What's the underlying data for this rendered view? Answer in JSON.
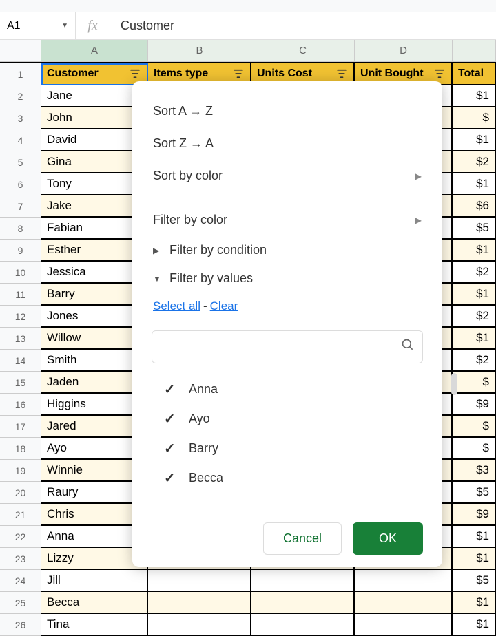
{
  "formula_bar": {
    "name_box": "A1",
    "fx": "fx",
    "value": "Customer"
  },
  "columns": [
    "A",
    "B",
    "C",
    "D",
    ""
  ],
  "header_row": {
    "a": "Customer",
    "b": "Items type",
    "c": "Units Cost",
    "d": "Unit Bought",
    "e": "Total"
  },
  "rows": [
    {
      "n": "1"
    },
    {
      "n": "2",
      "a": "Jane",
      "e": "$1"
    },
    {
      "n": "3",
      "a": "John",
      "e": "$"
    },
    {
      "n": "4",
      "a": "David",
      "e": "$1"
    },
    {
      "n": "5",
      "a": "Gina",
      "e": "$2"
    },
    {
      "n": "6",
      "a": "Tony",
      "e": "$1"
    },
    {
      "n": "7",
      "a": "Jake",
      "e": "$6"
    },
    {
      "n": "8",
      "a": "Fabian",
      "e": "$5"
    },
    {
      "n": "9",
      "a": "Esther",
      "e": "$1"
    },
    {
      "n": "10",
      "a": "Jessica",
      "e": "$2"
    },
    {
      "n": "11",
      "a": "Barry",
      "e": "$1"
    },
    {
      "n": "12",
      "a": "Jones",
      "e": "$2"
    },
    {
      "n": "13",
      "a": "Willow",
      "e": "$1"
    },
    {
      "n": "14",
      "a": "Smith",
      "e": "$2"
    },
    {
      "n": "15",
      "a": "Jaden",
      "e": "$"
    },
    {
      "n": "16",
      "a": "Higgins",
      "e": "$9"
    },
    {
      "n": "17",
      "a": "Jared",
      "e": "$"
    },
    {
      "n": "18",
      "a": "Ayo",
      "e": "$"
    },
    {
      "n": "19",
      "a": "Winnie",
      "e": "$3"
    },
    {
      "n": "20",
      "a": "Raury",
      "e": "$5"
    },
    {
      "n": "21",
      "a": "Chris",
      "e": "$9"
    },
    {
      "n": "22",
      "a": "Anna",
      "e": "$1"
    },
    {
      "n": "23",
      "a": "Lizzy",
      "e": "$1"
    },
    {
      "n": "24",
      "a": "Jill",
      "e": "$5"
    },
    {
      "n": "25",
      "a": "Becca",
      "e": "$1"
    },
    {
      "n": "26",
      "a": "Tina",
      "e": "$1"
    }
  ],
  "filter_menu": {
    "sort_az": "Sort A → Z",
    "sort_za": "Sort Z → A",
    "sort_color": "Sort by color",
    "filter_color": "Filter by color",
    "filter_condition": "Filter by condition",
    "filter_values": "Filter by values",
    "select_all": "Select all",
    "clear": "Clear",
    "search_placeholder": "",
    "values": [
      {
        "label": "Anna",
        "checked": true
      },
      {
        "label": "Ayo",
        "checked": true
      },
      {
        "label": "Barry",
        "checked": true
      },
      {
        "label": "Becca",
        "checked": true
      }
    ],
    "cancel": "Cancel",
    "ok": "OK"
  }
}
